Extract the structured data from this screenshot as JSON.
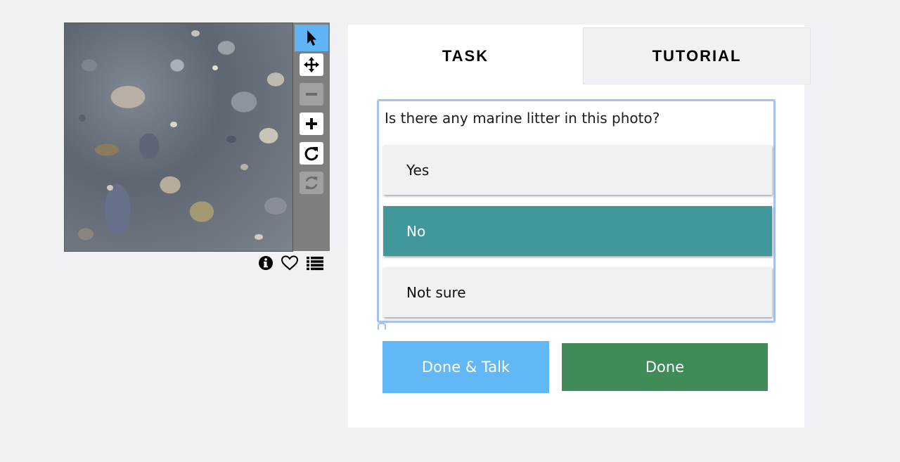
{
  "viewer": {
    "tools": [
      {
        "name": "pointer",
        "icon": "pointer-icon",
        "active": true
      },
      {
        "name": "pan",
        "icon": "move-icon",
        "active": false
      },
      {
        "name": "zoom-out",
        "icon": "minus-icon",
        "disabled": true
      },
      {
        "name": "zoom-in",
        "icon": "plus-icon"
      },
      {
        "name": "rotate",
        "icon": "rotate-icon"
      },
      {
        "name": "reset",
        "icon": "refresh-icon",
        "disabled": true
      }
    ],
    "meta_icons": [
      "info-icon",
      "heart-icon",
      "list-icon"
    ]
  },
  "tabs": {
    "task": "TASK",
    "tutorial": "TUTORIAL"
  },
  "task": {
    "question": "Is there any marine litter in this photo?",
    "answers": [
      {
        "label": "Yes",
        "selected": false
      },
      {
        "label": "No",
        "selected": true
      },
      {
        "label": "Not sure",
        "selected": false
      }
    ]
  },
  "buttons": {
    "done_talk": "Done & Talk",
    "done": "Done"
  },
  "colors": {
    "background": "#eff1f4",
    "active_tool": "#5fb4f5",
    "selected_answer": "#41989a",
    "done_talk": "#62b8f6",
    "done": "#3f8c58",
    "question_border": "#a6c2ec"
  }
}
